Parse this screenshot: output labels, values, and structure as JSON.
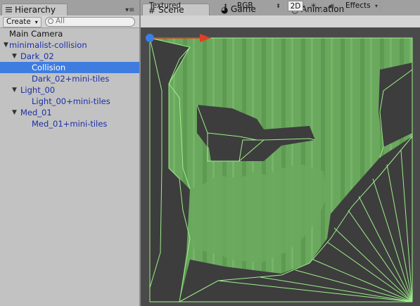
{
  "hierarchy": {
    "tab_label": "Hierarchy",
    "create_label": "Create",
    "search_placeholder": "All",
    "items": [
      {
        "label": "Main Camera",
        "depth": 0,
        "foldout": "",
        "color": "normal",
        "selected": false
      },
      {
        "label": "minimalist-collision",
        "depth": 0,
        "foldout": "▼",
        "color": "blue",
        "selected": false
      },
      {
        "label": "Dark_02",
        "depth": 1,
        "foldout": "▼",
        "color": "blue",
        "selected": false
      },
      {
        "label": "Collision",
        "depth": 2,
        "foldout": "",
        "color": "white",
        "selected": true
      },
      {
        "label": "Dark_02+mini-tiles",
        "depth": 2,
        "foldout": "",
        "color": "blue",
        "selected": false
      },
      {
        "label": "Light_00",
        "depth": 1,
        "foldout": "▼",
        "color": "blue",
        "selected": false
      },
      {
        "label": "Light_00+mini-tiles",
        "depth": 2,
        "foldout": "",
        "color": "blue",
        "selected": false
      },
      {
        "label": "Med_01",
        "depth": 1,
        "foldout": "▼",
        "color": "blue",
        "selected": false
      },
      {
        "label": "Med_01+mini-tiles",
        "depth": 2,
        "foldout": "",
        "color": "blue",
        "selected": false
      }
    ]
  },
  "scene_tabs": {
    "scene": "Scene",
    "game": "Game",
    "animation": "Animation",
    "scene_icon": "grid-icon",
    "game_icon": "pacman-icon",
    "animation_icon": "clock-icon"
  },
  "scene_toolbar": {
    "draw_mode": "Textured",
    "render_mode": "RGB",
    "mode_2d": "2D",
    "lighting_icon": "sun-icon",
    "audio_icon": "speaker-icon",
    "effects": "Effects"
  },
  "colors": {
    "selection": "#3e7ce0",
    "prefab_blue": "#1c2fa5",
    "scene_bg": "#4a4a4a",
    "terrain_light": "#6aa85e",
    "terrain_dark": "#3d3d3d",
    "collider_line": "#9ef08a",
    "gizmo_x": "#e04020",
    "gizmo_origin": "#3a7ee8"
  }
}
